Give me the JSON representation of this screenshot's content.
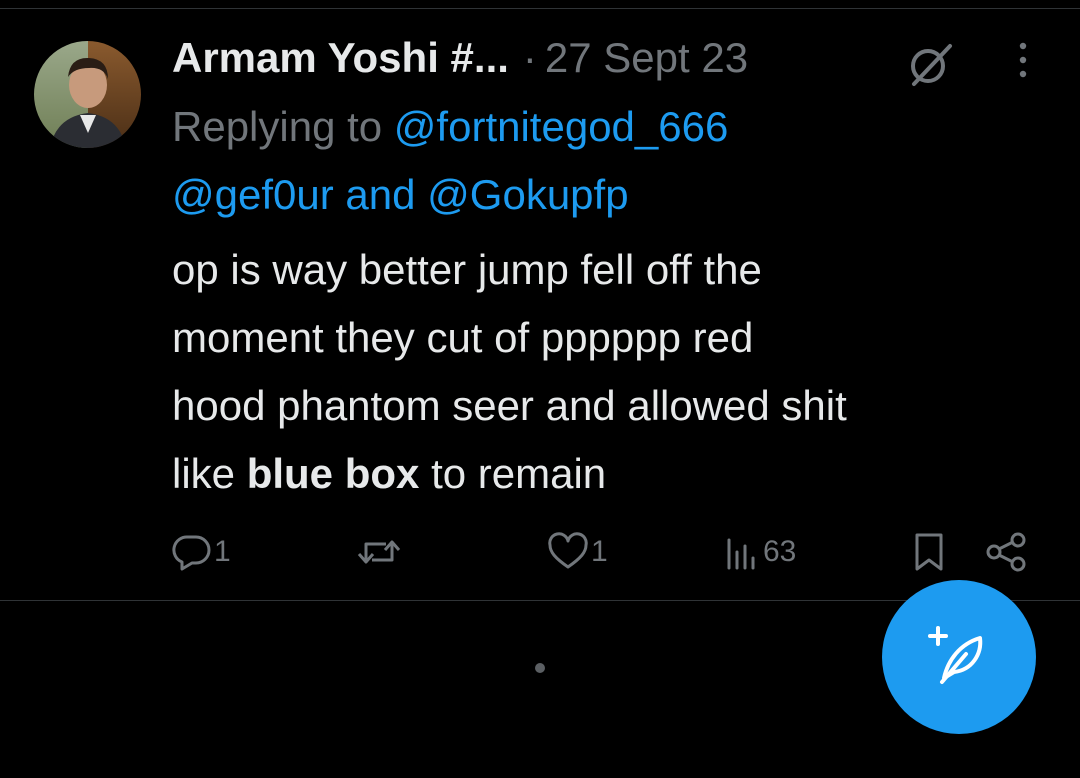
{
  "tweet": {
    "display_name": "Armam Yoshi #...",
    "separator": "·",
    "timestamp": "27 Sept 23",
    "replying_prefix": "Replying to",
    "mention_1": "@fortnitegod_666",
    "mention_2": "@gef0ur",
    "mention_joiner": "and",
    "mention_3": "@Gokupfp",
    "text_line_1": "op is way better jump fell off the",
    "text_line_2": "moment they cut of pppppp red",
    "text_line_3": "hood phantom seer and allowed shit",
    "text_line_4_prefix": "like",
    "text_line_4_bold": "blue box",
    "text_line_4_suffix": "to remain"
  },
  "actions": {
    "reply_count": "1",
    "like_count": "1",
    "views_count": "63"
  },
  "icons": {
    "grok": "grok-icon",
    "more": "more-vertical-icon",
    "reply": "reply-icon",
    "retweet": "retweet-icon",
    "like": "heart-icon",
    "views": "views-bar-icon",
    "bookmark": "bookmark-icon",
    "share": "share-icon",
    "compose": "compose-feather-icon"
  },
  "colors": {
    "background": "#000000",
    "text": "#e7e9ea",
    "muted": "#71767b",
    "link": "#1d9bf0",
    "fab": "#1d9bf0",
    "divider": "#2f3336"
  }
}
